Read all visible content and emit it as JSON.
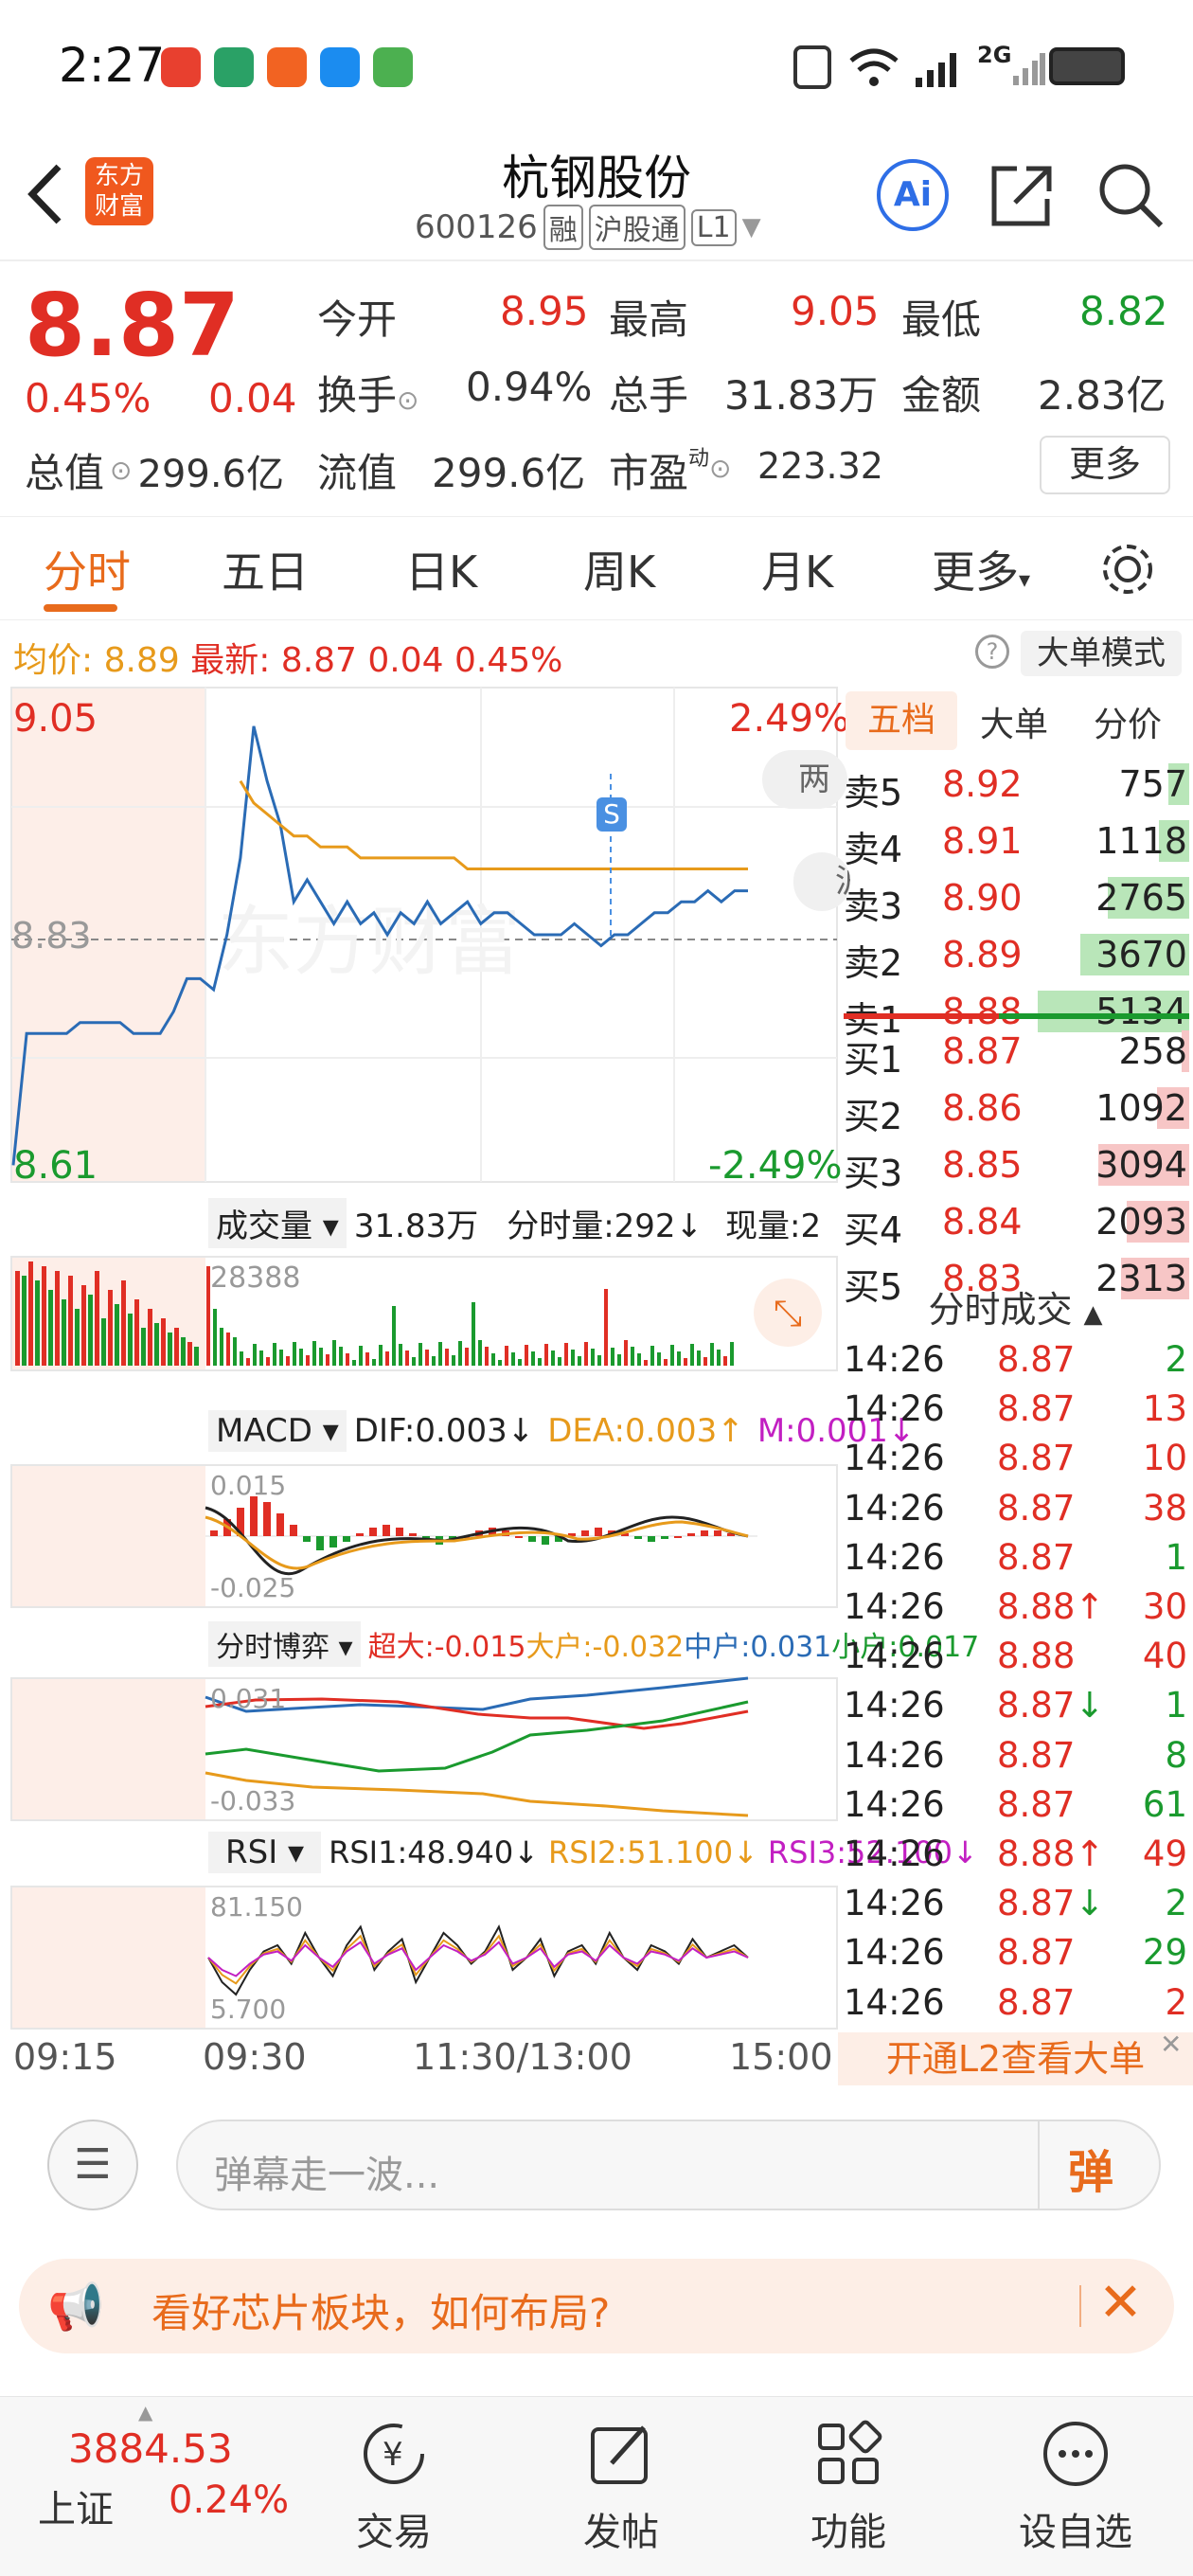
{
  "status": {
    "time": "2:27",
    "wifi": "wifi-icon",
    "signal": "signal-icon",
    "network": "2G",
    "battery": "battery-icon"
  },
  "header": {
    "logo_line1": "东方",
    "logo_line2": "财富",
    "title": "杭钢股份",
    "code": "600126",
    "tag_rong": "融",
    "tag_hgt": "沪股通",
    "tag_l1": "L1"
  },
  "quote": {
    "price": "8.87",
    "pct": "0.45%",
    "chg": "0.04",
    "open_label": "今开",
    "open": "8.95",
    "high_label": "最高",
    "high": "9.05",
    "low_label": "最低",
    "low": "8.82",
    "turn_label": "换手",
    "turn": "0.94%",
    "vol_label": "总手",
    "vol": "31.83万",
    "amt_label": "金额",
    "amt": "2.83亿",
    "cap_label": "总值",
    "cap": "299.6亿",
    "float_label": "流值",
    "float": "299.6亿",
    "pe_label": "市盈",
    "pe_sup": "动",
    "pe": "223.32",
    "more": "更多"
  },
  "tabs": [
    "分时",
    "五日",
    "日K",
    "周K",
    "月K",
    "更多"
  ],
  "infobar": {
    "avg_label": "均价:",
    "avg": "8.89",
    "last_label": "最新:",
    "last": "8.87",
    "chg": "0.04",
    "pct": "0.45%",
    "mode": "大单模式"
  },
  "chart": {
    "ymax": "9.05",
    "ymin": "8.61",
    "pmax": "2.49%",
    "pmin": "-2.49%",
    "pre": "8.83",
    "signal": "S",
    "watermark": "东方财富",
    "side_tag1": "两",
    "side_tag2": "沪",
    "vol_label": "成交量",
    "vol_total": "31.83万",
    "vol_tick": "分时量:292↓",
    "vol_now": "现量:2",
    "vol_max": "28388",
    "macd_label": "MACD",
    "dif": "DIF:0.003↓",
    "dea": "DEA:0.003↑",
    "m": "M:0.001↓",
    "macd_top": "0.015",
    "macd_bot": "-0.025",
    "game_label": "分时博弈",
    "g1": "超大:-0.015",
    "g2": "大户:-0.032",
    "g3": "中户:0.031",
    "g4": "小户:0.017",
    "game_top": "0.031",
    "game_bot": "-0.033",
    "rsi_label": "RSI",
    "rsi1": "RSI1:48.940↓",
    "rsi2": "RSI2:51.100↓",
    "rsi3": "RSI3:52.100↓",
    "rsi_top": "81.150",
    "rsi_bot": "5.700",
    "t1": "09:15",
    "t2": "09:30",
    "t3": "11:30/13:00",
    "t4": "15:00",
    "price_series": [
      8.62,
      8.74,
      8.74,
      8.74,
      8.74,
      8.75,
      8.75,
      8.75,
      8.75,
      8.74,
      8.74,
      8.74,
      8.76,
      8.79,
      8.79,
      8.78,
      8.83,
      8.9,
      9.02,
      8.97,
      8.93,
      8.86,
      8.88,
      8.86,
      8.84,
      8.86,
      8.84,
      8.85,
      8.83,
      8.85,
      8.84,
      8.86,
      8.84,
      8.85,
      8.86,
      8.84,
      8.85,
      8.85,
      8.84,
      8.83,
      8.83,
      8.83,
      8.84,
      8.83,
      8.82,
      8.83,
      8.83,
      8.84,
      8.85,
      8.85,
      8.86,
      8.86,
      8.87,
      8.86,
      8.87,
      8.87
    ],
    "avg_series": [
      null,
      null,
      null,
      null,
      null,
      null,
      null,
      null,
      null,
      null,
      null,
      null,
      null,
      null,
      null,
      null,
      null,
      8.97,
      8.95,
      8.94,
      8.93,
      8.92,
      8.92,
      8.91,
      8.91,
      8.91,
      8.9,
      8.9,
      8.9,
      8.9,
      8.9,
      8.9,
      8.9,
      8.9,
      8.89,
      8.89,
      8.89,
      8.89,
      8.89,
      8.89,
      8.89,
      8.89,
      8.89,
      8.89,
      8.89,
      8.89,
      8.89,
      8.89,
      8.89,
      8.89,
      8.89,
      8.89,
      8.89,
      8.89,
      8.89,
      8.89
    ],
    "macd_hist": [
      0.002,
      0.006,
      0.01,
      0.014,
      0.012,
      0.008,
      0.004,
      -0.002,
      -0.005,
      -0.004,
      -0.002,
      0.001,
      0.003,
      0.004,
      0.003,
      0.001,
      -0.002,
      -0.003,
      -0.002,
      0.0,
      0.002,
      0.003,
      0.002,
      0.0,
      -0.002,
      -0.003,
      -0.002,
      0.001,
      0.002,
      0.003,
      0.002,
      0.001,
      -0.001,
      -0.002,
      -0.001,
      0.0,
      0.001,
      0.002,
      0.002,
      0.001
    ],
    "rsi_series": [
      50,
      30,
      20,
      40,
      55,
      60,
      45,
      70,
      50,
      35,
      60,
      75,
      40,
      55,
      65,
      30,
      50,
      70,
      60,
      45,
      55,
      75,
      40,
      50,
      65,
      35,
      55,
      60,
      45,
      70,
      50,
      40,
      60,
      55,
      45,
      65,
      50,
      55,
      60,
      50
    ]
  },
  "book": {
    "tabs": [
      "五档",
      "大单",
      "分价"
    ],
    "sell": [
      {
        "label": "卖5",
        "price": "8.92",
        "vol": "757",
        "bar": 0.14
      },
      {
        "label": "卖4",
        "price": "8.91",
        "vol": "1118",
        "bar": 0.2
      },
      {
        "label": "卖3",
        "price": "8.90",
        "vol": "2765",
        "bar": 0.54
      },
      {
        "label": "卖2",
        "price": "8.89",
        "vol": "3670",
        "bar": 0.72
      },
      {
        "label": "卖1",
        "price": "8.88",
        "vol": "5134",
        "bar": 1.0
      }
    ],
    "buy": [
      {
        "label": "买1",
        "price": "8.87",
        "vol": "258",
        "bar": 0.05
      },
      {
        "label": "买2",
        "price": "8.86",
        "vol": "1092",
        "bar": 0.21
      },
      {
        "label": "买3",
        "price": "8.85",
        "vol": "3094",
        "bar": 0.6
      },
      {
        "label": "买4",
        "price": "8.84",
        "vol": "2093",
        "bar": 0.41
      },
      {
        "label": "买5",
        "price": "8.83",
        "vol": "2313",
        "bar": 0.45
      }
    ],
    "ticks_title": "分时成交",
    "ticks": [
      {
        "t": "14:26",
        "p": "8.87",
        "v": "2"
      },
      {
        "t": "14:26",
        "p": "8.87",
        "v": "13"
      },
      {
        "t": "14:26",
        "p": "8.87",
        "v": "10"
      },
      {
        "t": "14:26",
        "p": "8.87",
        "v": "38"
      },
      {
        "t": "14:26",
        "p": "8.87",
        "v": "1"
      },
      {
        "t": "14:26",
        "p": "8.88↑",
        "v": "30"
      },
      {
        "t": "14:26",
        "p": "8.88",
        "v": "40"
      },
      {
        "t": "14:26",
        "p": "8.87↓",
        "v": "1"
      },
      {
        "t": "14:26",
        "p": "8.87",
        "v": "8"
      },
      {
        "t": "14:26",
        "p": "8.87",
        "v": "61"
      },
      {
        "t": "14:26",
        "p": "8.88↑",
        "v": "49"
      },
      {
        "t": "14:26",
        "p": "8.87↓",
        "v": "2"
      },
      {
        "t": "14:26",
        "p": "8.87",
        "v": "29"
      },
      {
        "t": "14:26",
        "p": "8.87",
        "v": "2"
      }
    ],
    "l2": "开通L2查看大单"
  },
  "dm": {
    "placeholder": "弹幕走一波...",
    "send": "弹"
  },
  "promo": {
    "text": "看好芯片板块，如何布局?"
  },
  "nav": {
    "index_value": "3884.53",
    "index_name": "上证",
    "index_pct": "0.24%",
    "items": [
      "交易",
      "发帖",
      "功能",
      "设自选"
    ]
  }
}
